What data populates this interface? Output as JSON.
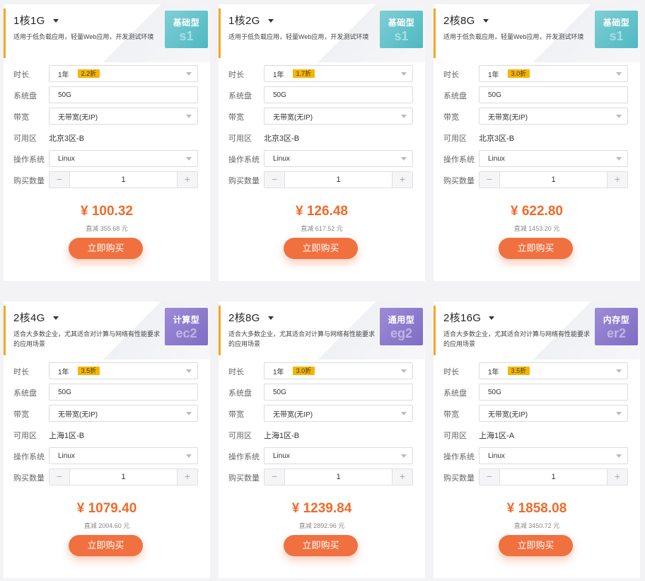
{
  "labels": {
    "duration": "时长",
    "disk": "系统盘",
    "bandwidth": "带宽",
    "zone": "可用区",
    "os": "操作系统",
    "quantity": "购买数量",
    "buy": "立即购买",
    "minus": "−",
    "plus": "+"
  },
  "colors": {
    "accent": "#f5a623",
    "price": "#f06a2a",
    "button": "#f07040",
    "discount_tag": "#f7b500",
    "badge_teal": "#4eb8c2",
    "badge_purple": "#7e6dc4"
  },
  "cards": [
    {
      "title": "1核1G",
      "desc": "适用于低负载应用，轻量Web应用，开发测试环境",
      "type": "基础型",
      "code": "s1",
      "badge_color": "teal",
      "duration": "1年",
      "discount": "2.2折",
      "disk": "50G",
      "bandwidth": "无带宽(无IP)",
      "zone": "北京3区-B",
      "os": "Linux",
      "qty": "1",
      "price": "¥ 100.32",
      "saved": "直减 355.68 元"
    },
    {
      "title": "1核2G",
      "desc": "适用于低负载应用，轻量Web应用，开发测试环境",
      "type": "基础型",
      "code": "s1",
      "badge_color": "teal",
      "duration": "1年",
      "discount": "1.7折",
      "disk": "50G",
      "bandwidth": "无带宽(无IP)",
      "zone": "北京3区-B",
      "os": "Linux",
      "qty": "1",
      "price": "¥ 126.48",
      "saved": "直减 617.52 元"
    },
    {
      "title": "2核8G",
      "desc": "适用于低负载应用，轻量Web应用，开发测试环境",
      "type": "基础型",
      "code": "s1",
      "badge_color": "teal",
      "duration": "1年",
      "discount": "3.0折",
      "disk": "50G",
      "bandwidth": "无带宽(无IP)",
      "zone": "北京3区-B",
      "os": "Linux",
      "qty": "1",
      "price": "¥ 622.80",
      "saved": "直减 1453.20 元"
    },
    {
      "title": "2核4G",
      "desc": "适合大多数企业，尤其适合对计算与网络有性能要求的应用场景",
      "type": "计算型",
      "code": "ec2",
      "badge_color": "purple",
      "duration": "1年",
      "discount": "3.5折",
      "disk": "50G",
      "bandwidth": "无带宽(无IP)",
      "zone": "上海1区-B",
      "os": "Linux",
      "qty": "1",
      "price": "¥ 1079.40",
      "saved": "直减 2004.60 元"
    },
    {
      "title": "2核8G",
      "desc": "适合大多数企业，尤其适合对计算与网络有性能要求的应用场景",
      "type": "通用型",
      "code": "eg2",
      "badge_color": "purple",
      "duration": "1年",
      "discount": "3.0折",
      "disk": "50G",
      "bandwidth": "无带宽(无IP)",
      "zone": "上海1区-B",
      "os": "Linux",
      "qty": "1",
      "price": "¥ 1239.84",
      "saved": "直减 2892.96 元"
    },
    {
      "title": "2核16G",
      "desc": "适合大多数企业，尤其适合对计算与网络有性能要求的应用场景",
      "type": "内存型",
      "code": "er2",
      "badge_color": "purple",
      "duration": "1年",
      "discount": "3.5折",
      "disk": "50G",
      "bandwidth": "无带宽(无IP)",
      "zone": "上海1区-A",
      "os": "Linux",
      "qty": "1",
      "price": "¥ 1858.08",
      "saved": "直减 3450.72 元"
    }
  ]
}
